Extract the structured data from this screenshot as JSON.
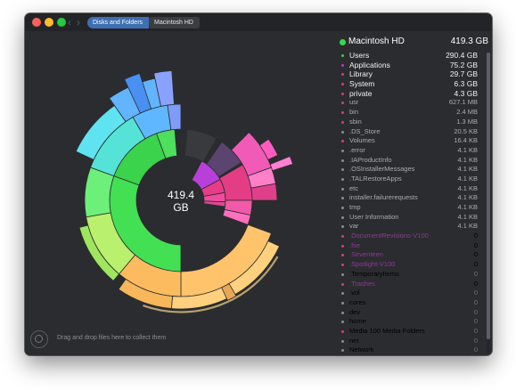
{
  "titlebar": {
    "back_icon": "chevron-left-icon",
    "forward_icon": "chevron-right-icon",
    "breadcrumbs": [
      "Disks and Folders",
      "Macintosh HD"
    ]
  },
  "sunburst": {
    "center_value": "419.4",
    "center_unit": "GB"
  },
  "dropzone": {
    "text": "Drag and drop files here to collect them"
  },
  "panel": {
    "header": {
      "name": "Macintosh HD",
      "size": "419.3 GB",
      "color": "#36d64a"
    },
    "items": [
      {
        "name": "Users",
        "size": "290.4 GB",
        "color": "#37d24a",
        "style": "big"
      },
      {
        "name": "Applications",
        "size": "75.2 GB",
        "color": "#b23bd6",
        "style": "big"
      },
      {
        "name": "Library",
        "size": "29.7 GB",
        "color": "#e0397a",
        "style": "big"
      },
      {
        "name": "System",
        "size": "6.3 GB",
        "color": "#e0397a",
        "style": "big"
      },
      {
        "name": "private",
        "size": "4.3 GB",
        "color": "#e0397a",
        "style": "big"
      },
      {
        "name": "usr",
        "size": "627.1 MB",
        "color": "#e0397a",
        "style": "small"
      },
      {
        "name": "bin",
        "size": "2.4 MB",
        "color": "#e0397a",
        "style": "small"
      },
      {
        "name": "sbin",
        "size": "1.3 MB",
        "color": "#e0397a",
        "style": "small"
      },
      {
        "name": ".DS_Store",
        "size": "20.5 KB",
        "color": "#8a8d92",
        "style": "small"
      },
      {
        "name": "Volumes",
        "size": "16.4 KB",
        "color": "#e0397a",
        "style": "small"
      },
      {
        "name": ".error",
        "size": "4.1 KB",
        "color": "#8a8d92",
        "style": "small"
      },
      {
        "name": ".IAProductInfo",
        "size": "4.1 KB",
        "color": "#8a8d92",
        "style": "small"
      },
      {
        "name": ".OSInstallerMessages",
        "size": "4.1 KB",
        "color": "#8a8d92",
        "style": "small"
      },
      {
        "name": ".TALRestoreApps",
        "size": "4.1 KB",
        "color": "#8a8d92",
        "style": "small"
      },
      {
        "name": "etc",
        "size": "4.1 KB",
        "color": "#8a8d92",
        "style": "small"
      },
      {
        "name": "installer.failurerequests",
        "size": "4.1 KB",
        "color": "#8a8d92",
        "style": "small"
      },
      {
        "name": "tmp",
        "size": "4.1 KB",
        "color": "#8a8d92",
        "style": "small"
      },
      {
        "name": "User Information",
        "size": "4.1 KB",
        "color": "#8a8d92",
        "style": "small"
      },
      {
        "name": "var",
        "size": "4.1 KB",
        "color": "#8a8d92",
        "style": "small"
      },
      {
        "name": ".DocumentRevisions-V100",
        "size": "0",
        "color": "#e0397a",
        "style": "purple"
      },
      {
        "name": ".fse",
        "size": "0",
        "color": "#e0397a",
        "style": "purple"
      },
      {
        "name": ".Seventeen",
        "size": "0",
        "color": "#e0397a",
        "style": "purple"
      },
      {
        "name": ".Spotlight-V100",
        "size": "0",
        "color": "#e0397a",
        "style": "purple"
      },
      {
        "name": ".TemporaryItems",
        "size": "0",
        "color": "#8a8d92",
        "style": "zero"
      },
      {
        "name": ".Trashes",
        "size": "0",
        "color": "#e0397a",
        "style": "purple"
      },
      {
        "name": ".vol",
        "size": "0",
        "color": "#8a8d92",
        "style": "zero"
      },
      {
        "name": "cores",
        "size": "0",
        "color": "#8a8d92",
        "style": "zero"
      },
      {
        "name": "dev",
        "size": "0",
        "color": "#8a8d92",
        "style": "zero"
      },
      {
        "name": "home",
        "size": "0",
        "color": "#8a8d92",
        "style": "zero"
      },
      {
        "name": "Media 100 Media Folders",
        "size": "0",
        "color": "#e0397a",
        "style": "zero"
      },
      {
        "name": "net",
        "size": "0",
        "color": "#8a8d92",
        "style": "zero"
      },
      {
        "name": "Network",
        "size": "0",
        "color": "#8a8d92",
        "style": "zero"
      },
      {
        "name": "(hidden space)",
        "size": "12.9 GB",
        "color": "#e0397a",
        "style": "hidden-row"
      }
    ]
  }
}
